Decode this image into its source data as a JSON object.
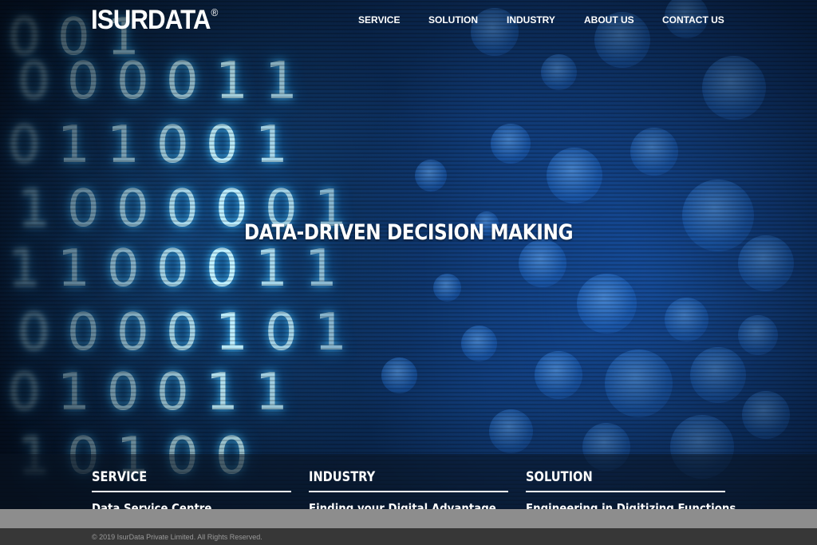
{
  "brand": {
    "logo_text": "ISURDATA",
    "registered_mark": "®"
  },
  "nav": {
    "items": [
      {
        "label": "SERVICE"
      },
      {
        "label": "SOLUTION"
      },
      {
        "label": "INDUSTRY"
      },
      {
        "label": "ABOUT US"
      },
      {
        "label": "CONTACT US"
      }
    ]
  },
  "hero": {
    "headline": "DATA-DRIVEN DECISION MAKING"
  },
  "features": [
    {
      "title": "SERVICE",
      "link": "Data Service Centre"
    },
    {
      "title": "INDUSTRY",
      "link": "Finding your Digital Advantage"
    },
    {
      "title": "SOLUTION",
      "link": "Engineering in Digitizing Functions"
    }
  ],
  "footer": {
    "copyright": "© 2019 IsurData Private Limited. All Rights Reserved."
  },
  "colors": {
    "accent_text": "#ffffff",
    "footer_bg": "#373737",
    "strip_bg": "#8d8d8d"
  }
}
